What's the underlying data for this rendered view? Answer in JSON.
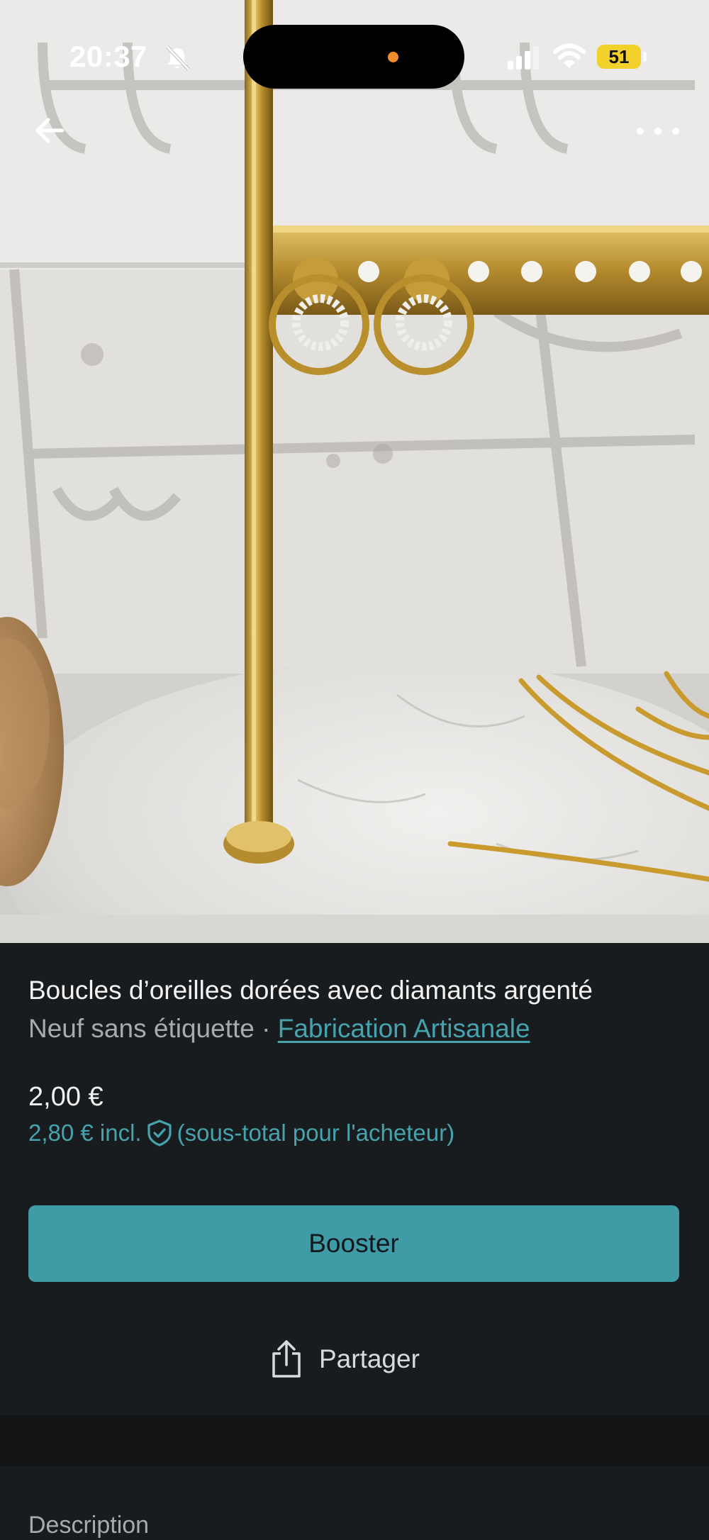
{
  "status_bar": {
    "time": "20:37",
    "battery_level": "51",
    "icons": [
      "bell-slash-icon",
      "signal-icon",
      "wifi-icon",
      "battery-icon"
    ]
  },
  "nav": {
    "back_icon": "arrow-left-icon",
    "more_icon": "more-horizontal-icon"
  },
  "photo": {
    "subject": "product-photo"
  },
  "item": {
    "title": "Boucles d’oreilles dorées avec diamants argenté",
    "condition": "Neuf sans étiquette",
    "separator": " · ",
    "brand": "Fabrication Artisanale",
    "price": "2,00 €",
    "price_incl": "2,80 € incl.",
    "price_incl_note": "(sous-total pour l'acheteur)"
  },
  "actions": {
    "booster_label": "Booster",
    "share_label": "Partager"
  },
  "description": {
    "label": "Description"
  },
  "colors": {
    "accent": "#3f9ca7",
    "link": "#46a3ad",
    "background": "#191c1e",
    "battery": "#f2d12a"
  }
}
